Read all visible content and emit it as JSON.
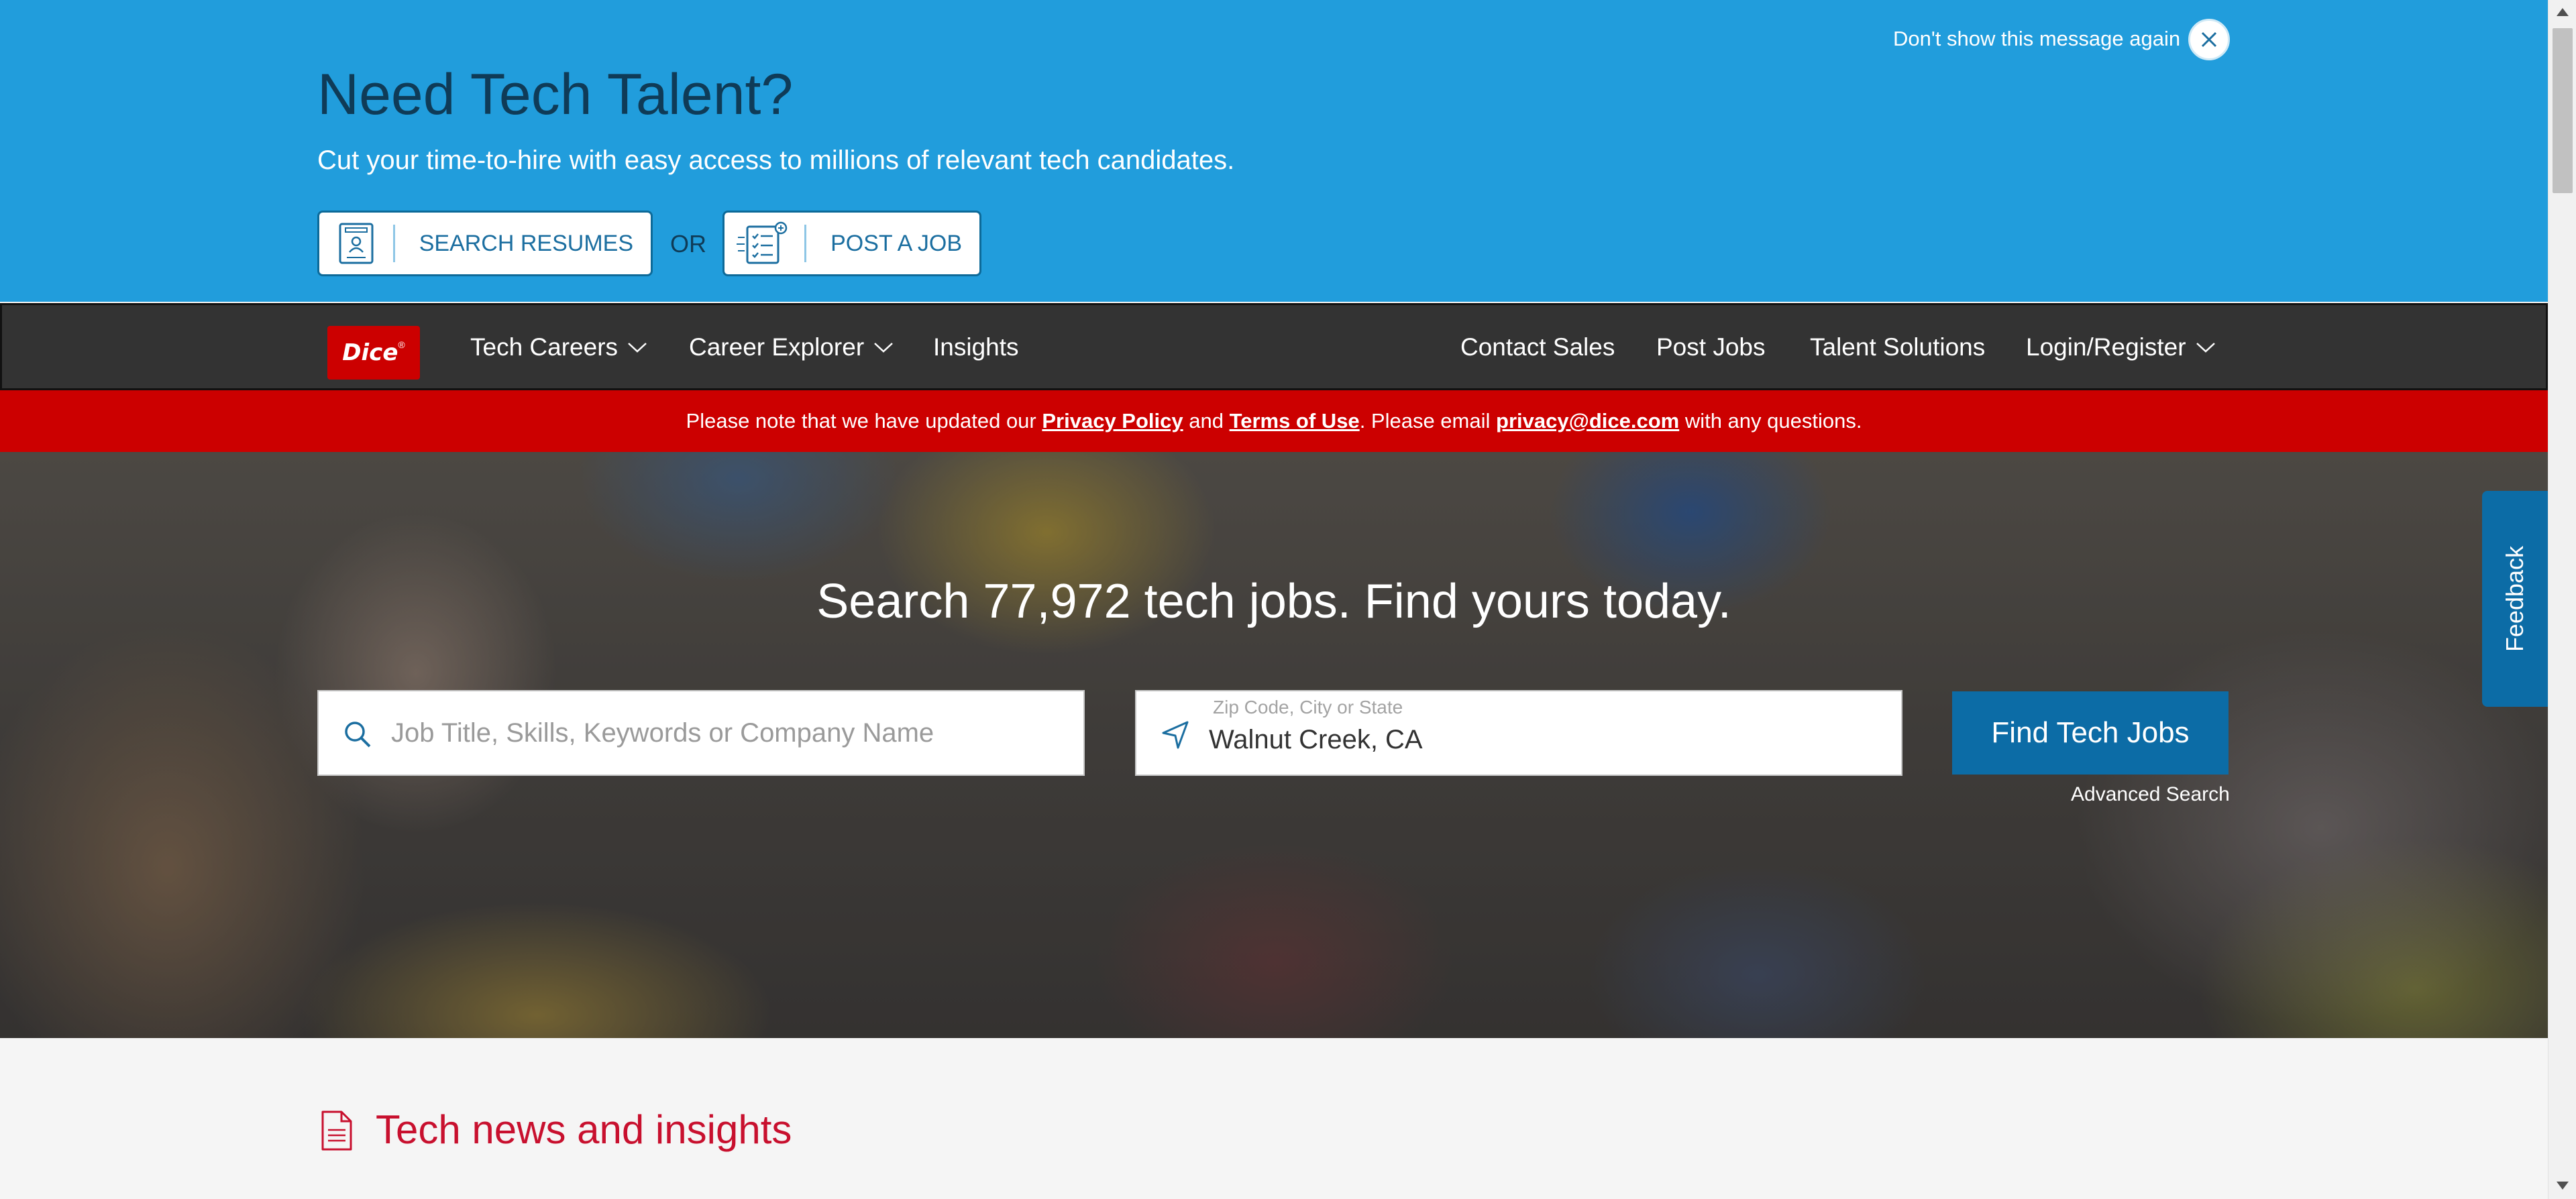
{
  "promo": {
    "title": "Need Tech Talent?",
    "subtitle": "Cut your time-to-hire with easy access to millions of relevant tech candidates.",
    "search_resumes_label": "SEARCH RESUMES",
    "or_label": "OR",
    "post_job_label": "POST A JOB",
    "dismiss_label": "Don't show this message again"
  },
  "nav": {
    "logo_text": "Dice",
    "logo_mark": "®",
    "items_left": [
      "Tech Careers",
      "Career Explorer",
      "Insights"
    ],
    "items_right": [
      "Contact Sales",
      "Post Jobs",
      "Talent Solutions",
      "Login/Register"
    ]
  },
  "privacy": {
    "text_1": "Please note that we have updated our ",
    "link_policy": "Privacy Policy",
    "text_2": " and ",
    "link_terms": "Terms of Use",
    "text_3": ". Please email ",
    "link_email": "privacy@dice.com",
    "text_4": " with any questions."
  },
  "hero": {
    "title": "Search 77,972 tech jobs. Find yours today.",
    "keyword_placeholder": "Job Title, Skills, Keywords or Company Name",
    "keyword_value": "",
    "location_label": "Zip Code, City or State",
    "location_value": "Walnut Creek, CA",
    "find_button": "Find Tech Jobs",
    "advanced_search": "Advanced Search"
  },
  "feedback": {
    "label": "Feedback"
  },
  "news": {
    "title": "Tech news and insights"
  },
  "colors": {
    "promo_bg": "#219ddc",
    "nav_bg": "#333333",
    "privacy_bg": "#cc0000",
    "brand_red": "#cc0000",
    "primary_blue": "#0c6ca6",
    "news_title": "#c8102e"
  },
  "icons": {
    "resume": "resume-document-icon",
    "post_job": "job-list-icon",
    "close": "close-icon",
    "search": "search-icon",
    "location": "location-arrow-icon",
    "chevron": "chevron-down-icon",
    "news": "document-icon"
  }
}
